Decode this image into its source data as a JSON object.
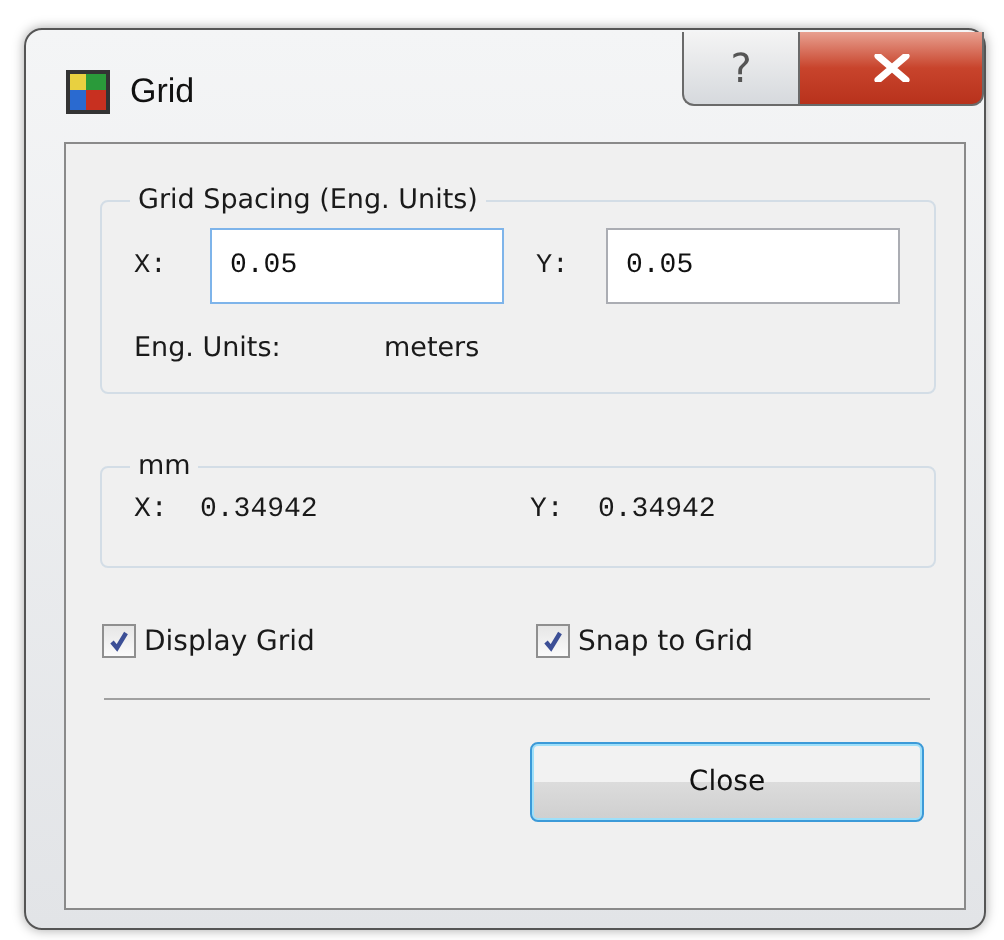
{
  "window": {
    "title": "Grid",
    "help_button": "?"
  },
  "grid_spacing": {
    "legend": "Grid Spacing (Eng. Units)",
    "x_label": "X:",
    "x_value": "0.05",
    "x_focused": true,
    "y_label": "Y:",
    "y_value": "0.05",
    "units_label": "Eng. Units:",
    "units_value": "meters"
  },
  "mm": {
    "legend": "mm",
    "x_label": "X:",
    "x_value": "0.34942",
    "y_label": "Y:",
    "y_value": "0.34942"
  },
  "checkboxes": [
    {
      "label": "Display Grid",
      "checked": true
    },
    {
      "label": "Snap to Grid",
      "checked": true
    }
  ],
  "buttons": [
    {
      "label": "Close",
      "focused": true
    }
  ]
}
